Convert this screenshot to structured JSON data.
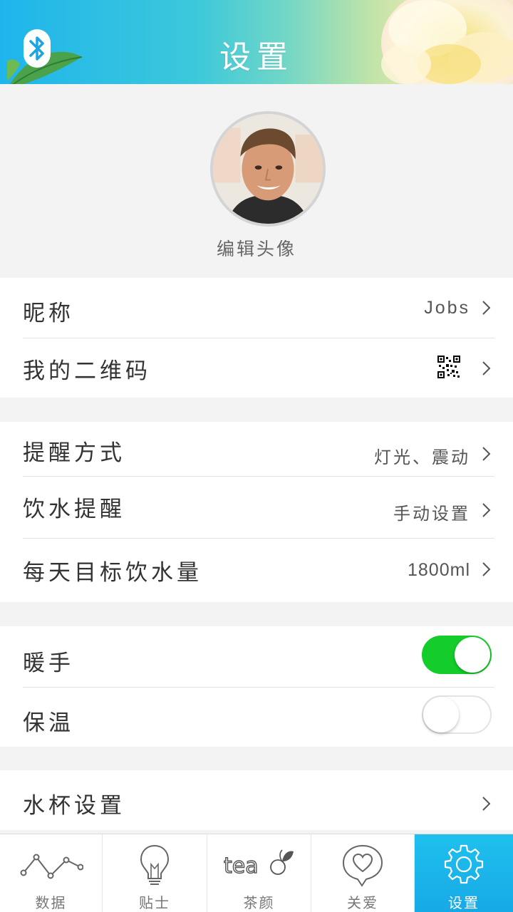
{
  "header": {
    "title": "设置",
    "bluetooth_icon": "bluetooth-icon",
    "gradient": [
      "#1fb5ec",
      "#f6e9c9"
    ]
  },
  "profile": {
    "edit_avatar_label": "编辑头像"
  },
  "account": {
    "nickname_label": "昵称",
    "nickname_value": "Jobs",
    "qrcode_label": "我的二维码",
    "qrcode_icon": "qr-code-icon"
  },
  "reminders": {
    "reminder_mode_label": "提醒方式",
    "reminder_mode_value": "灯光、震动",
    "drink_reminder_label": "饮水提醒",
    "drink_reminder_value": "手动设置",
    "daily_goal_label": "每天目标饮水量",
    "daily_goal_value": "1800ml"
  },
  "warmth": {
    "hand_warmer_label": "暖手",
    "hand_warmer_on": true,
    "keep_warm_label": "保温",
    "keep_warm_on": false,
    "toggle_on_color": "#14cc2a"
  },
  "cup": {
    "cup_settings_label": "水杯设置"
  },
  "tabbar": {
    "active_color": "#17a9e6",
    "tabs": [
      {
        "label": "数据",
        "icon": "line-chart-icon"
      },
      {
        "label": "贴士",
        "icon": "lightbulb-icon"
      },
      {
        "label": "茶颜",
        "icon": "tea-logo-icon"
      },
      {
        "label": "关爱",
        "icon": "heart-bubble-icon"
      },
      {
        "label": "设置",
        "icon": "gear-icon",
        "active": true
      }
    ]
  }
}
